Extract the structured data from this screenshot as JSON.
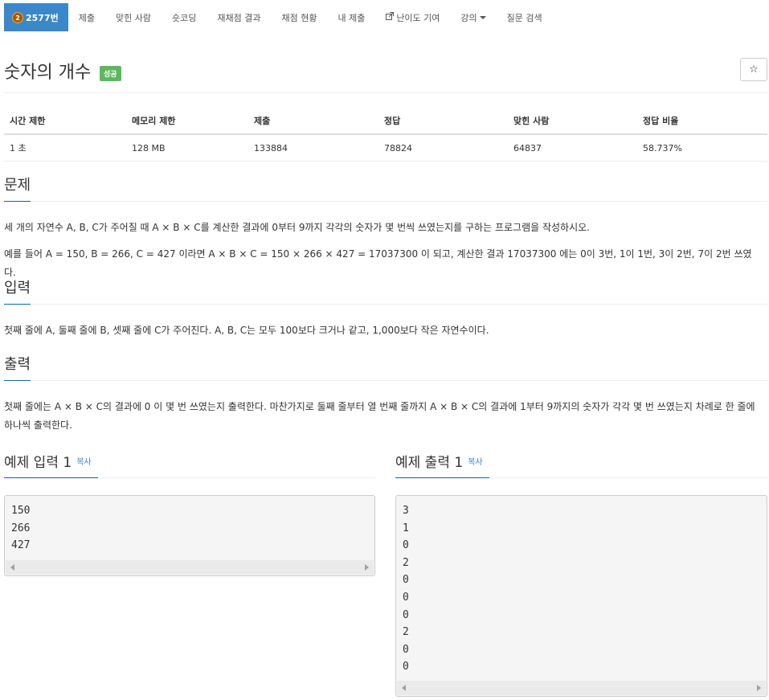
{
  "nav": {
    "problem_badge": "2",
    "problem_label": "2577번",
    "items": [
      "제출",
      "맞힌 사람",
      "숏코딩",
      "재채점 결과",
      "채점 현황",
      "내 제출",
      "난이도 기여",
      "강의",
      "질문 검색"
    ]
  },
  "title": {
    "text": "숫자의 개수",
    "badge": "성공",
    "star_icon": "☆"
  },
  "info": {
    "headers": [
      "시간 제한",
      "메모리 제한",
      "제출",
      "정답",
      "맞힌 사람",
      "정답 비율"
    ],
    "values": [
      "1 초",
      "128 MB",
      "133884",
      "78824",
      "64837",
      "58.737%"
    ]
  },
  "problem": {
    "heading": "문제",
    "para1": "세 개의 자연수 A, B, C가 주어질 때 A × B × C를 계산한 결과에 0부터 9까지 각각의 숫자가 몇 번씩 쓰였는지를 구하는 프로그램을 작성하시오.",
    "para2": "예를 들어 A = 150, B = 266, C = 427 이라면 A × B × C = 150 × 266 × 427 = 17037300 이 되고, 계산한 결과 17037300 에는 0이 3번, 1이 1번, 3이 2번, 7이 2번 쓰였다."
  },
  "input": {
    "heading": "입력",
    "text": "첫째 줄에 A, 둘째 줄에 B, 셋째 줄에 C가 주어진다. A, B, C는 모두 100보다 크거나 같고, 1,000보다 작은 자연수이다."
  },
  "output": {
    "heading": "출력",
    "text": "첫째 줄에는 A × B × C의 결과에 0 이 몇 번 쓰였는지 출력한다. 마찬가지로 둘째 줄부터 열 번째 줄까지 A × B × C의 결과에 1부터 9까지의 숫자가 각각 몇 번 쓰였는지 차례로 한 줄에 하나씩 출력한다."
  },
  "sample_input": {
    "heading": "예제 입력 1",
    "copy": "복사",
    "lines": [
      "150",
      "266",
      "427"
    ]
  },
  "sample_output": {
    "heading": "예제 출력 1",
    "copy": "복사",
    "lines": [
      "3",
      "1",
      "0",
      "2",
      "0",
      "0",
      "0",
      "2",
      "0",
      "0"
    ]
  },
  "colors": {
    "nav_active": "#3a87c9",
    "success_badge": "#5cb85c",
    "link": "#3a87c9",
    "section_underline": "#0a6aa1"
  }
}
